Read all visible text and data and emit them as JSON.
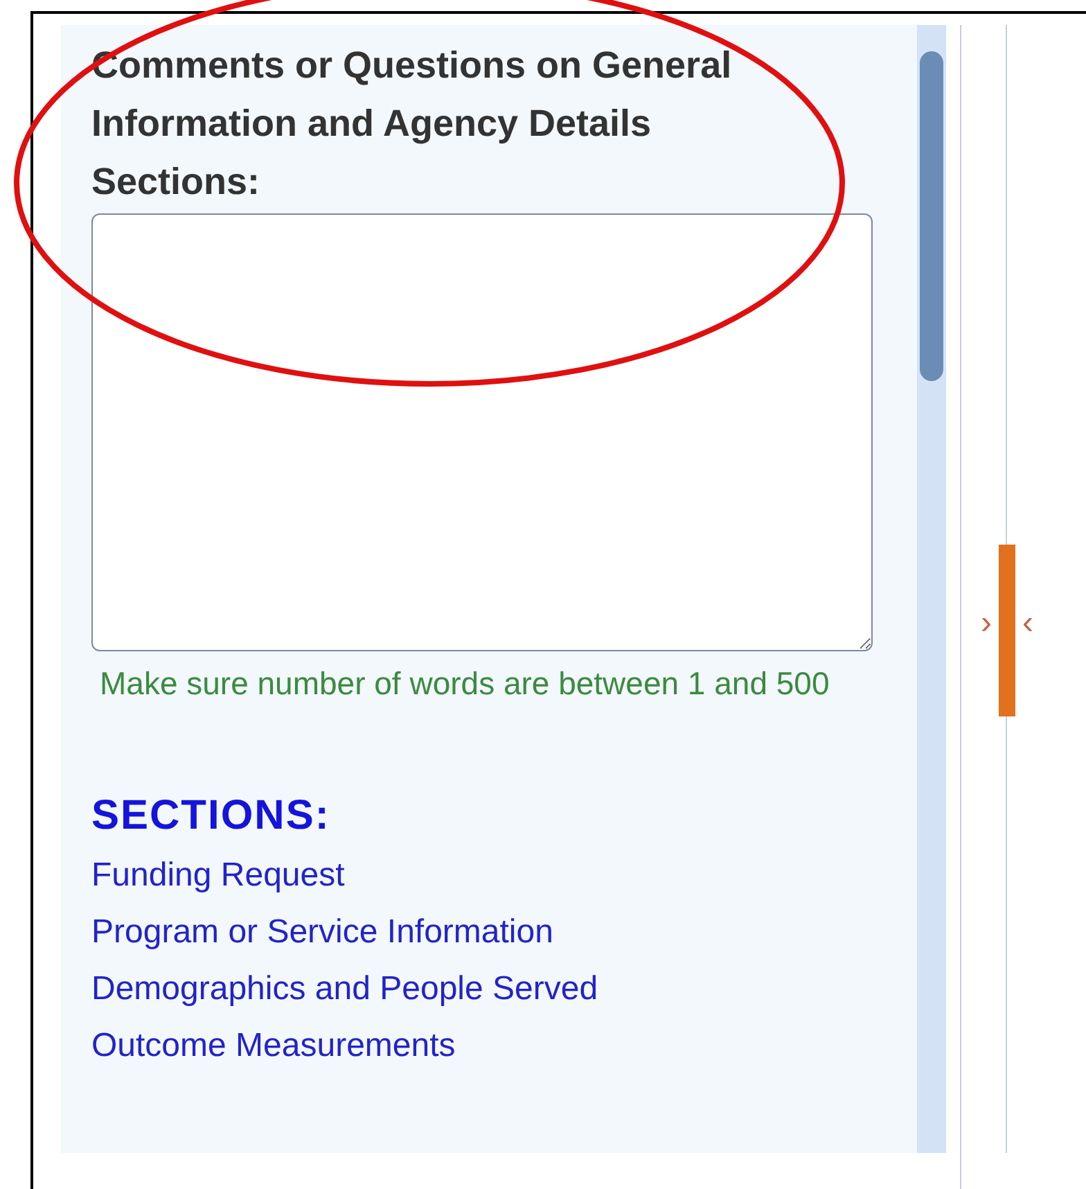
{
  "comment_field": {
    "label": "Comments or Questions on General Information and Agency Details Sections:",
    "hint": "Make sure number of words are between 1 and 500"
  },
  "sections": {
    "heading": "SECTIONS:",
    "links": [
      "Funding Request",
      "Program or Service Information",
      "Demographics and People Served",
      "Outcome Measurements"
    ]
  },
  "splitter": {
    "left_arrow": "›",
    "right_arrow": "‹"
  }
}
